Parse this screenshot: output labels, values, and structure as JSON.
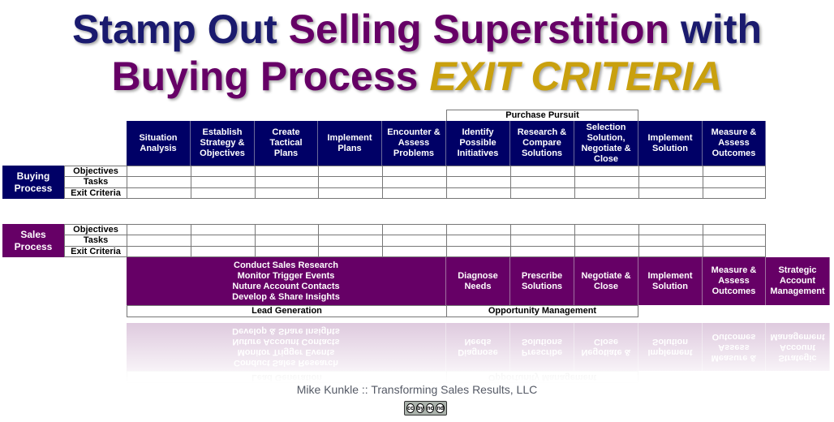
{
  "title": {
    "line1": [
      {
        "text": "Stamp Out ",
        "color": "navy"
      },
      {
        "text": "Selling Superstition ",
        "color": "plum"
      },
      {
        "text": "with",
        "color": "navy"
      }
    ],
    "line2": [
      {
        "text": "Buying Process ",
        "color": "plum"
      },
      {
        "text": "EXIT CRITERIA",
        "color": "gold"
      }
    ],
    "colors": {
      "navy": "#1a1a6e",
      "plum": "#660066",
      "gold": "#c9a00e"
    }
  },
  "buying": {
    "group_label": "Purchase Pursuit",
    "process_label": "Buying Process",
    "header_color": "#000066",
    "stages": [
      "Situation Analysis",
      "Establish Strategy & Objectives",
      "Create Tactical Plans",
      "Implement Plans",
      "Encounter & Assess Problems",
      "Identify Possible Initiatives",
      "Research & Compare Solutions",
      "Selection Solution, Negotiate & Close",
      "Implement Solution",
      "Measure & Assess Outcomes"
    ],
    "rows": [
      "Objectives",
      "Tasks",
      "Exit Criteria"
    ]
  },
  "sales": {
    "process_label": "Sales Process",
    "header_color": "#660066",
    "rows": [
      "Objectives",
      "Tasks",
      "Exit Criteria"
    ],
    "lead_activities": [
      "Conduct Sales Research",
      "Monitor Trigger Events",
      "Nuture Account Contacts",
      "Develop & Share Insights"
    ],
    "stages": [
      "Diagnose Needs",
      "Prescribe Solutions",
      "Negotiate & Close",
      "Implement Solution",
      "Measure & Assess Outcomes",
      "Strategic Account Management"
    ],
    "phase_labels": {
      "lead_generation": "Lead Generation",
      "opportunity_management": "Opportunity Management"
    }
  },
  "footer": {
    "credit": "Mike Kunkle ::  Transforming Sales Results, LLC",
    "license_icon": "creative-commons-by-nc-nd-icon",
    "license_marks": [
      "cc",
      "by",
      "nc",
      "nd"
    ]
  }
}
